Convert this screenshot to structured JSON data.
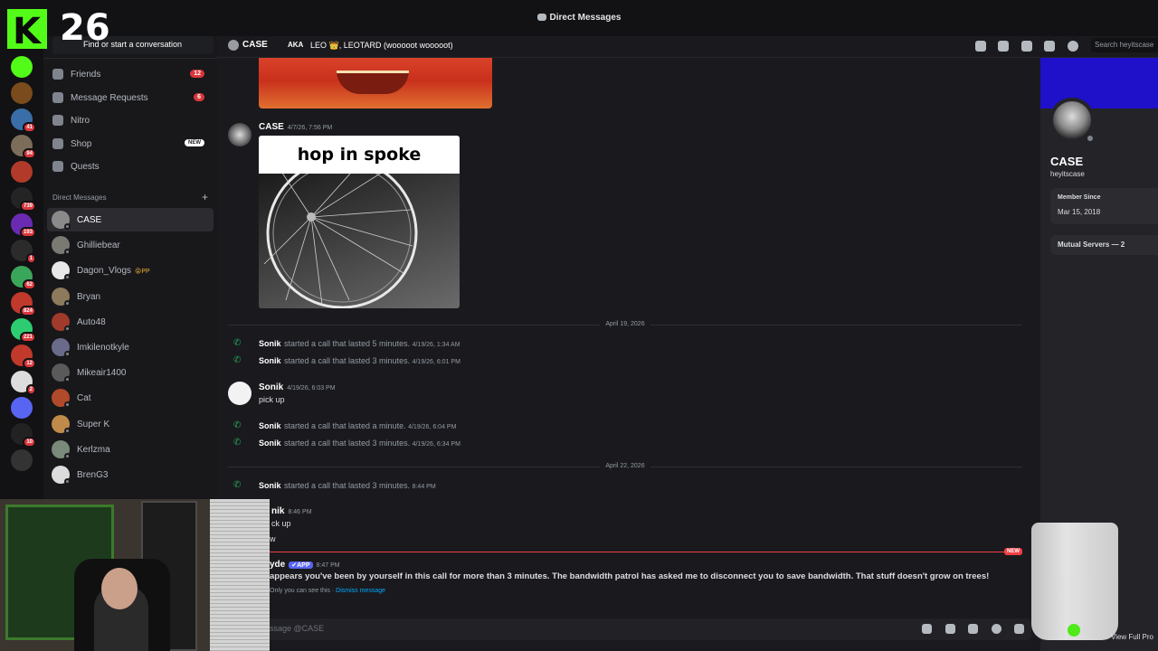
{
  "window": {
    "title": "Direct Messages"
  },
  "overlay": {
    "count": "26",
    "logo_letter": "K"
  },
  "rail": {
    "servers": [
      {
        "badge": "",
        "color": "#53fc18"
      },
      {
        "badge": "",
        "color": "#7a4b1c"
      },
      {
        "badge": "41",
        "color": "#3a6ea8"
      },
      {
        "badge": "94",
        "color": "#7c6c5a"
      },
      {
        "badge": "",
        "color": "#b23a2b"
      },
      {
        "badge": "739",
        "color": "#242424"
      },
      {
        "badge": "193",
        "color": "#6a2bb2"
      },
      {
        "badge": "1",
        "color": "#2b2b2b"
      },
      {
        "badge": "62",
        "color": "#3aa65a"
      },
      {
        "badge": "824",
        "color": "#c0392b"
      },
      {
        "badge": "221",
        "color": "#2ecc71"
      },
      {
        "badge": "12",
        "color": "#c0392b"
      },
      {
        "badge": "2",
        "color": "#dddddd"
      },
      {
        "badge": "",
        "color": "#5865f2"
      },
      {
        "badge": "10",
        "color": "#222222"
      },
      {
        "badge": "",
        "color": "#333333"
      }
    ]
  },
  "dmlist": {
    "finder_placeholder": "Find or start a conversation",
    "nav": [
      {
        "label": "Friends",
        "badge": "12",
        "new": false
      },
      {
        "label": "Message Requests",
        "badge": "6",
        "new": false
      },
      {
        "label": "Nitro",
        "badge": "",
        "new": false
      },
      {
        "label": "Shop",
        "badge": "",
        "new": true,
        "new_label": "NEW"
      },
      {
        "label": "Quests",
        "badge": "",
        "new": false
      }
    ],
    "section_title": "Direct Messages",
    "section_plus": "+",
    "dms": [
      {
        "name": "CASE",
        "active": true,
        "tag": "",
        "color": "#8a8a8a"
      },
      {
        "name": "Ghilliebear",
        "active": false,
        "tag": "",
        "color": "#7a7a72"
      },
      {
        "name": "Dagon_Vlogs",
        "active": false,
        "tag": "😝PP",
        "color": "#e8e8e8"
      },
      {
        "name": "Bryan",
        "active": false,
        "tag": "",
        "color": "#8d7a5c"
      },
      {
        "name": "Auto48",
        "active": false,
        "tag": "",
        "color": "#a03a2a"
      },
      {
        "name": "Imkilenotkyle",
        "active": false,
        "tag": "",
        "color": "#6a6a8a"
      },
      {
        "name": "Mikeair1400",
        "active": false,
        "tag": "",
        "color": "#5a5a5a"
      },
      {
        "name": "Cat",
        "active": false,
        "tag": "",
        "color": "#b04a2a"
      },
      {
        "name": "Super K",
        "active": false,
        "tag": "",
        "color": "#c08a4a"
      },
      {
        "name": "Kerlzma",
        "active": false,
        "tag": "",
        "color": "#7a8a7a"
      },
      {
        "name": "BrenG3",
        "active": false,
        "tag": "",
        "color": "#dcdcdc"
      }
    ]
  },
  "header": {
    "name": "CASE",
    "aka": "AKA",
    "nicknames": "LEO 👑, LEOTARD (wooooot wooooot)",
    "search_placeholder": "Search heyitscase"
  },
  "messages": {
    "meme_author": "CASE",
    "meme_time": "4/7/26, 7:56 PM",
    "meme_caption": "hop in spoke",
    "date1": "April 19, 2026",
    "calls1": [
      {
        "who": "Sonik",
        "text": "started a call that lasted 5 minutes.",
        "time": "4/19/26, 1:34 AM"
      },
      {
        "who": "Sonik",
        "text": "started a call that lasted 3 minutes.",
        "time": "4/19/26, 6:01 PM"
      }
    ],
    "sonik_msg": {
      "author": "Sonik",
      "time": "4/19/26, 6:03 PM",
      "body": "pick up"
    },
    "calls2": [
      {
        "who": "Sonik",
        "text": "started a call that lasted a minute.",
        "time": "4/19/26, 6:04 PM"
      },
      {
        "who": "Sonik",
        "text": "started a call that lasted 3 minutes.",
        "time": "4/19/26, 6:34 PM"
      }
    ],
    "date2": "April 22, 2026",
    "call3": {
      "who": "Sonik",
      "text": "started a call that lasted 3 minutes.",
      "time": "8:44 PM"
    },
    "partial_author": "nik",
    "partial_time": "8:46 PM",
    "partial_body1": "ck up",
    "partial_body2": "w",
    "new_label": "NEW",
    "clyde_author": "yde",
    "clyde_app": "✔APP",
    "clyde_time": "8:47 PM",
    "clyde_text": "appears you've been by yourself in this call for more than 3 minutes. The bandwidth patrol has asked me to disconnect you to save bandwidth. That stuff doesn't grow on trees!",
    "only_you": "Only you can see this ·",
    "dismiss": "Dismiss message"
  },
  "composer": {
    "placeholder": "ssage @CASE"
  },
  "profile": {
    "name": "CASE",
    "username": "heyitscase",
    "member_since_label": "Member Since",
    "member_since": "Mar 15, 2018",
    "mutual": "Mutual Servers — 2",
    "view_full": "View Full Pro"
  }
}
